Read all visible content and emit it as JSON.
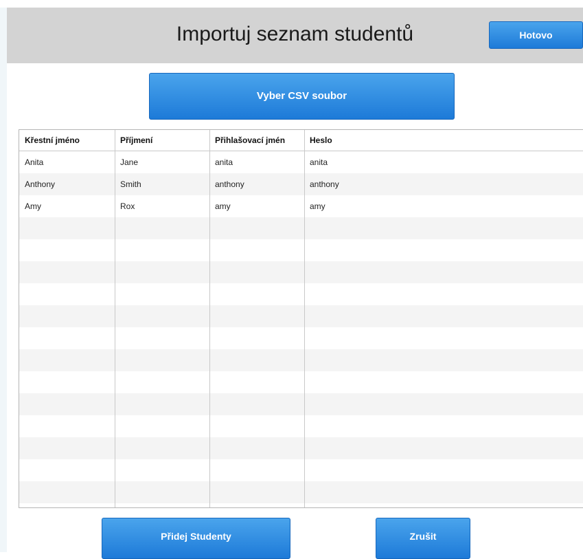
{
  "header": {
    "title": "Importuj seznam studentů",
    "done_label": "Hotovo"
  },
  "csv_button": {
    "label": "Vyber CSV soubor"
  },
  "table": {
    "columns": [
      "Křestní jméno",
      "Příjmení",
      "Přihlašovací jmén",
      "Heslo"
    ],
    "rows": [
      [
        "Anita",
        "Jane",
        "anita",
        "anita"
      ],
      [
        "Anthony",
        "Smith",
        "anthony",
        "anthony"
      ],
      [
        "Amy",
        "Rox",
        "amy",
        "amy"
      ]
    ]
  },
  "footer": {
    "add_label": "Přidej Studenty",
    "cancel_label": "Zrušit"
  },
  "colors": {
    "accent": "#2a8ae0",
    "header_bg": "#d3d3d3",
    "alt_row": "#f4f4f4"
  }
}
